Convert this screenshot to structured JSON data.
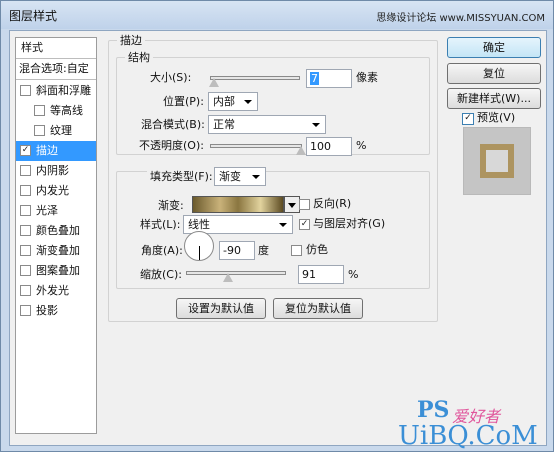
{
  "window": {
    "title": "图层样式",
    "watermark_top": "思缘设计论坛 www.MISSYUAN.COM"
  },
  "styles_list": {
    "header": "样式",
    "blend_options": "混合选项:自定",
    "items": [
      {
        "label": "斜面和浮雕",
        "checked": false
      },
      {
        "label": "等高线",
        "checked": false
      },
      {
        "label": "纹理",
        "checked": false
      },
      {
        "label": "描边",
        "checked": true
      },
      {
        "label": "内阴影",
        "checked": false
      },
      {
        "label": "内发光",
        "checked": false
      },
      {
        "label": "光泽",
        "checked": false
      },
      {
        "label": "颜色叠加",
        "checked": false
      },
      {
        "label": "渐变叠加",
        "checked": false
      },
      {
        "label": "图案叠加",
        "checked": false
      },
      {
        "label": "外发光",
        "checked": false
      },
      {
        "label": "投影",
        "checked": false
      }
    ]
  },
  "stroke": {
    "title": "描边",
    "structure": {
      "title": "结构",
      "size_label": "大小(S):",
      "size_value": "7",
      "size_unit": "像素",
      "size_fraction": 0.03,
      "position_label": "位置(P):",
      "position_value": "内部",
      "blend_label": "混合模式(B):",
      "blend_value": "正常",
      "opacity_label": "不透明度(O):",
      "opacity_value": "100",
      "opacity_unit": "%",
      "opacity_fraction": 1.0
    },
    "fill": {
      "type_label": "填充类型(F):",
      "type_value": "渐变",
      "gradient_label": "渐变:",
      "reverse_label": "反向(R)",
      "reverse_checked": false,
      "style_label": "样式(L):",
      "style_value": "线性",
      "align_label": "与图层对齐(G)",
      "align_checked": true,
      "angle_label": "角度(A):",
      "angle_value": "-90",
      "angle_unit": "度",
      "dither_label": "仿色",
      "dither_checked": false,
      "scale_label": "缩放(C):",
      "scale_value": "91",
      "scale_unit": "%",
      "scale_fraction": 0.42
    },
    "make_default": "设置为默认值",
    "reset_default": "复位为默认值"
  },
  "buttons": {
    "ok": "确定",
    "reset": "复位",
    "new_style": "新建样式(W)...",
    "preview_label": "预览(V)",
    "preview_checked": true
  },
  "colors": {
    "selected": "#3399ff",
    "gradient_gold": "#c9b27a"
  },
  "watermarks": {
    "ps_logo": "PS",
    "site_cn": "爱好者",
    "site_en": "UiBQ.CoM"
  }
}
